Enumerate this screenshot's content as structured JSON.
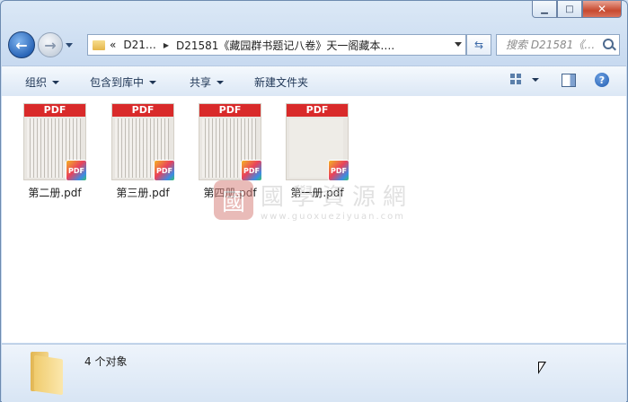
{
  "window": {
    "caption_buttons": [
      "minimize",
      "maximize",
      "close"
    ]
  },
  "address": {
    "prefix": "«",
    "crumbs": [
      "D21…",
      "D21581《藏园群书题记八卷》天一阁藏本…."
    ]
  },
  "search": {
    "placeholder": "搜索 D21581《…"
  },
  "toolbar": {
    "organize": "组织",
    "include_library": "包含到库中",
    "share": "共享",
    "new_folder": "新建文件夹"
  },
  "files": [
    {
      "name": "第二册.pdf",
      "badge": "PDF",
      "thumb": "pages"
    },
    {
      "name": "第三册.pdf",
      "badge": "PDF",
      "thumb": "pages"
    },
    {
      "name": "第四册.pdf",
      "badge": "PDF",
      "thumb": "pages"
    },
    {
      "name": "第一册.pdf",
      "badge": "PDF",
      "thumb": "title"
    }
  ],
  "watermark": {
    "text": "國學資源網",
    "url": "www.guoxueziyuan.com"
  },
  "status": {
    "count": "4 个对象"
  },
  "colors": {
    "ribbon": "#d92a2a",
    "status_bg": "#d8e5f4",
    "toolbar_bg": "#dbe7f5"
  }
}
